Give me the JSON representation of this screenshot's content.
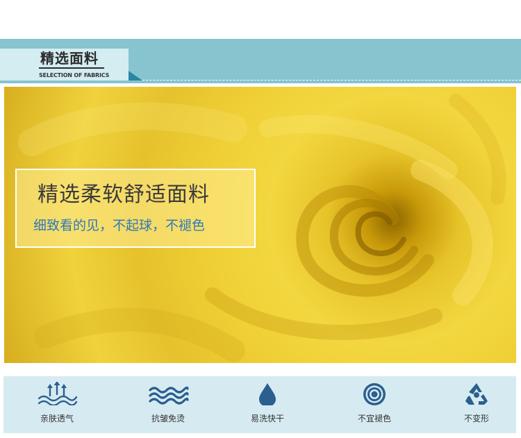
{
  "section": {
    "title": "精选面料",
    "subtitle": "SELECTION OF FABRICS"
  },
  "hero": {
    "headline": "精选柔软舒适面料",
    "tagline": "细致看的见，不起球，不褪色"
  },
  "features": [
    {
      "icon": "breathable-arrows-icon",
      "label": "亲肤透气"
    },
    {
      "icon": "wave-lines-icon",
      "label": "抗皱免烫"
    },
    {
      "icon": "water-drop-icon",
      "label": "易洗快干"
    },
    {
      "icon": "concentric-circles-icon",
      "label": "不宜褪色"
    },
    {
      "icon": "recycle-icon",
      "label": "不变形"
    }
  ],
  "colors": {
    "section_bar": "#86c4cf",
    "title_box": "#d3edf1",
    "accent_blue": "#2a86a3",
    "fabric_yellow": "#f0d23c",
    "tagline_blue": "#2f78b8",
    "feature_bg": "#d6ebf1",
    "icon_blue": "#2a5f8f"
  }
}
